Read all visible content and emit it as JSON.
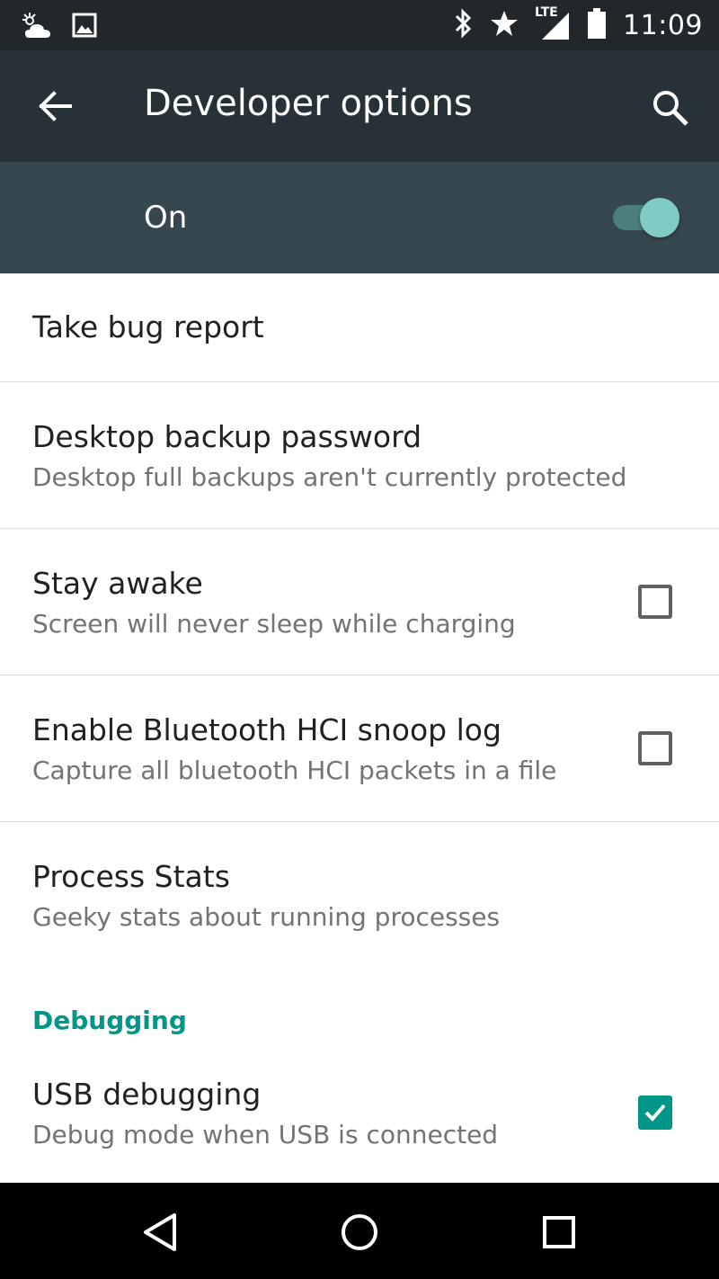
{
  "status_bar": {
    "time": "11:09",
    "network_label": "LTE",
    "left_icons": [
      "weather-cloud-icon",
      "image-icon"
    ],
    "right_icons": [
      "bluetooth-icon",
      "star-icon",
      "signal-icon",
      "battery-icon"
    ]
  },
  "toolbar": {
    "title": "Developer options",
    "back_icon": "arrow-back-icon",
    "search_icon": "search-icon"
  },
  "master_switch": {
    "label": "On",
    "state": "on"
  },
  "preferences": [
    {
      "title": "Take bug report"
    },
    {
      "title": "Desktop backup password",
      "summary": "Desktop full backups aren't currently protected"
    },
    {
      "title": "Stay awake",
      "summary": "Screen will never sleep while charging",
      "checked": false
    },
    {
      "title": "Enable Bluetooth HCI snoop log",
      "summary": "Capture all bluetooth HCI packets in a file",
      "checked": false
    },
    {
      "title": "Process Stats",
      "summary": "Geeky stats about running processes"
    }
  ],
  "debugging": {
    "category": "Debugging",
    "items": [
      {
        "title": "USB debugging",
        "summary": "Debug mode when USB is connected",
        "checked": true
      }
    ]
  },
  "nav_bar": {
    "icons": [
      "back-triangle-icon",
      "home-circle-icon",
      "recents-square-icon"
    ]
  },
  "colors": {
    "status_bar": "#21272b",
    "toolbar": "#263238",
    "master_bar": "#37474f",
    "accent": "#009688",
    "switch_thumb": "#80cbc4"
  }
}
